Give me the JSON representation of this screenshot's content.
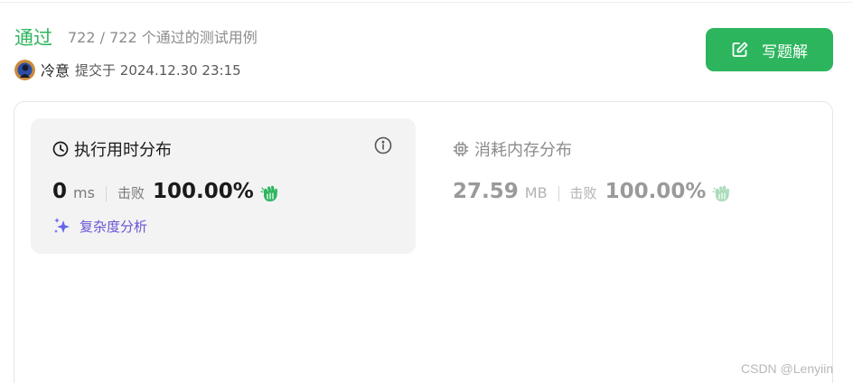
{
  "submission": {
    "status": "通过",
    "testcase_summary": "722 / 722 个通过的测试用例",
    "author": "冷意",
    "submitted_at": "提交于 2024.12.30 23:15"
  },
  "actions": {
    "write_solution_label": "写题解"
  },
  "runtime": {
    "title": "执行用时分布",
    "value": "0",
    "unit": "ms",
    "beat_label": "击败",
    "beat_percent": "100.00%",
    "analysis_link": "复杂度分析"
  },
  "memory": {
    "title": "消耗内存分布",
    "value": "27.59",
    "unit": "MB",
    "beat_label": "击败",
    "beat_percent": "100.00%"
  },
  "watermark": "CSDN @Lenyiin",
  "colors": {
    "accent": "#2db55d",
    "analysis": "#6b54d6"
  },
  "icons": [
    "clock-icon",
    "info-icon",
    "cpu-icon",
    "clap-icon",
    "sparkle-icon",
    "edit-icon"
  ]
}
